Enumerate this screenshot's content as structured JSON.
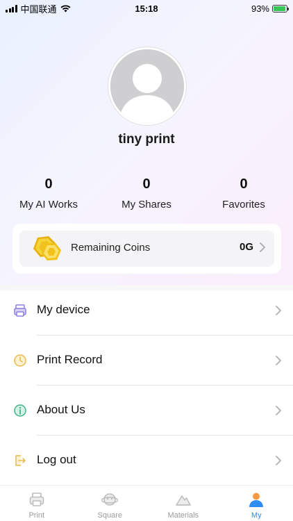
{
  "status_bar": {
    "carrier": "中国联通",
    "time": "15:18",
    "battery": "93%",
    "battery_level": 0.93
  },
  "profile": {
    "username": "tiny print",
    "avatar_icon": "default-user-avatar"
  },
  "stats": [
    {
      "value": "0",
      "label": "My AI Works"
    },
    {
      "value": "0",
      "label": "My Shares"
    },
    {
      "value": "0",
      "label": "Favorites"
    }
  ],
  "coins": {
    "label": "Remaining Coins",
    "value": "0G",
    "icon": "gold-coin-icon"
  },
  "menu": [
    {
      "label": "My device",
      "icon": "printer-icon"
    },
    {
      "label": "Print Record",
      "icon": "clock-icon"
    },
    {
      "label": "About Us",
      "icon": "info-icon"
    },
    {
      "label": "Log out",
      "icon": "logout-icon"
    }
  ],
  "tabs": [
    {
      "label": "Print",
      "icon": "printer-tab-icon",
      "active": false
    },
    {
      "label": "Square",
      "icon": "planet-tab-icon",
      "active": false
    },
    {
      "label": "Materials",
      "icon": "mountain-tab-icon",
      "active": false
    },
    {
      "label": "My",
      "icon": "person-tab-icon",
      "active": true
    }
  ],
  "colors": {
    "accent": "#2f8df2",
    "coin": "#f3c623",
    "profile_orange": "#f29a45"
  }
}
